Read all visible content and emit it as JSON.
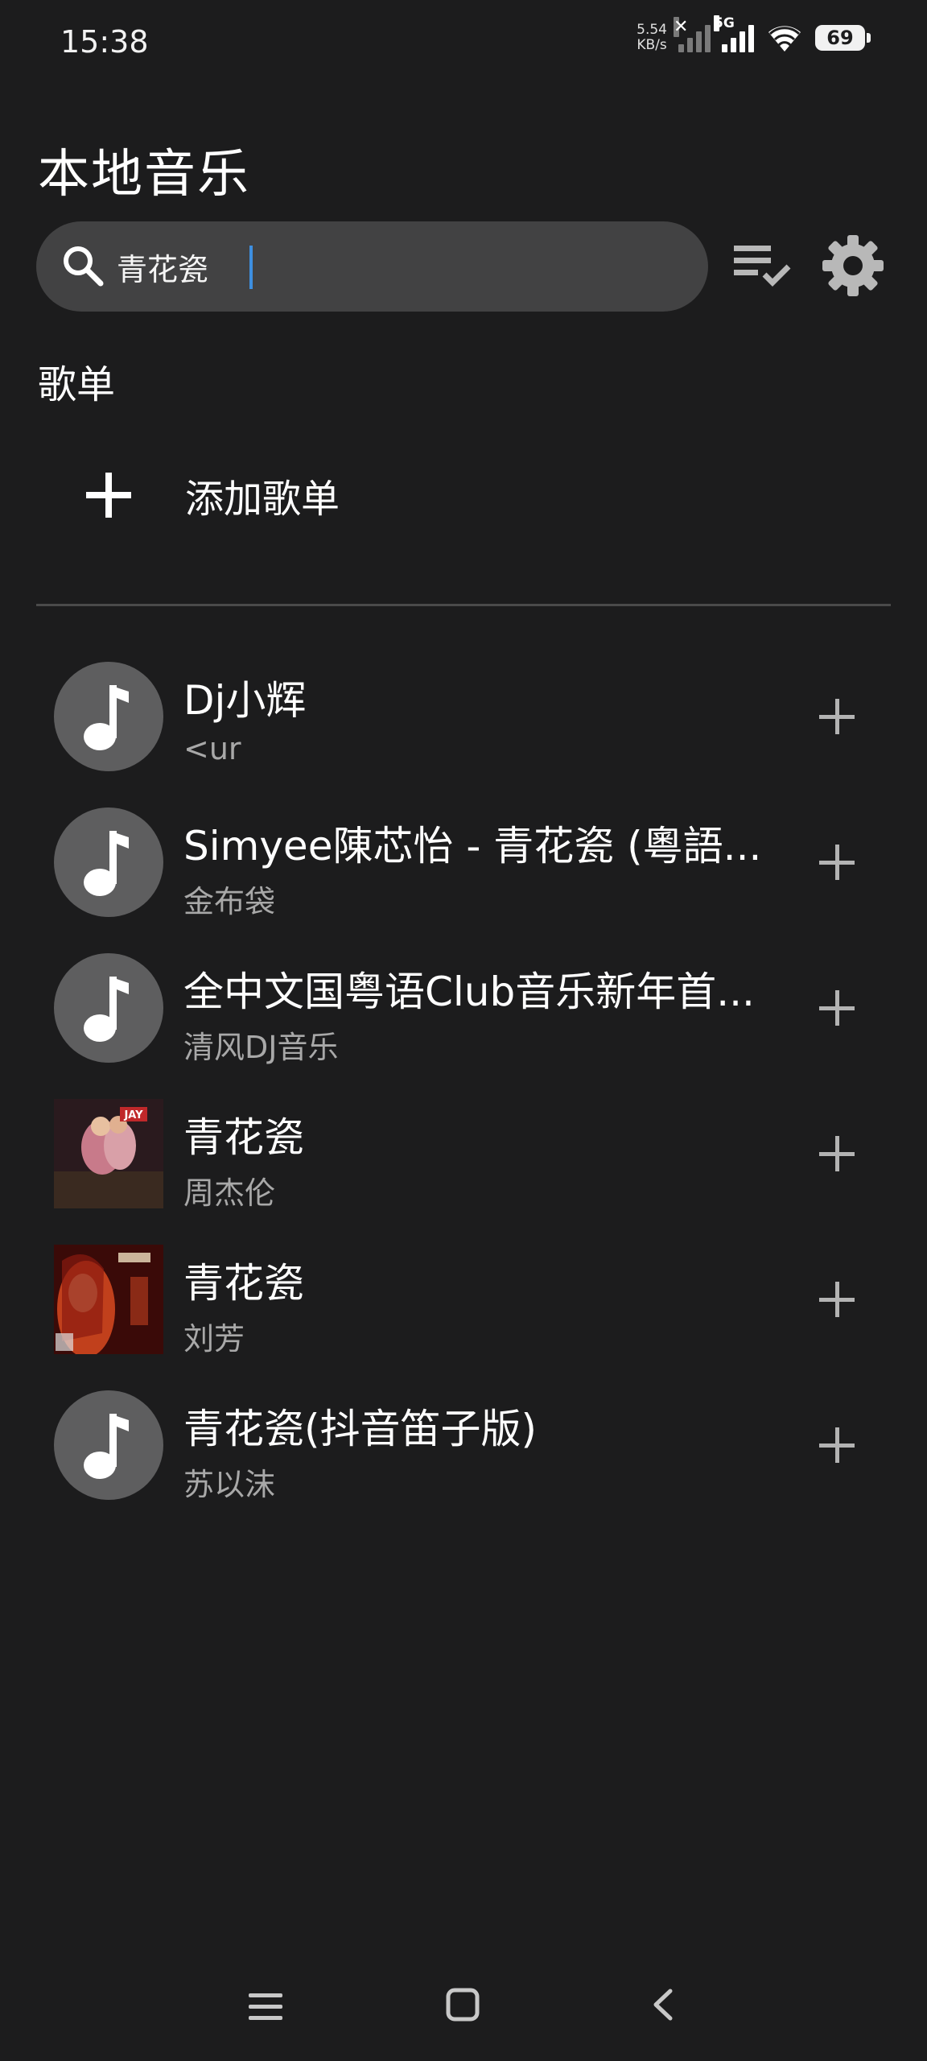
{
  "status_bar": {
    "time": "15:38",
    "net_speed_value": "5.54",
    "net_speed_unit": "KB/s",
    "network_type": "5G",
    "battery": "69"
  },
  "header": {
    "title": "本地音乐"
  },
  "search": {
    "value": "青花瓷",
    "placeholder": ""
  },
  "playlists": {
    "section_title": "歌单",
    "add_label": "添加歌单"
  },
  "songs": [
    {
      "title": " Dj小辉",
      "artist": "<ur",
      "cover": "music-note"
    },
    {
      "title": "Simyee陳芯怡 - 青花瓷 (粵語...",
      "artist": "金布袋",
      "cover": "music-note"
    },
    {
      "title": "全中文国粤语Club音乐新年首...",
      "artist": "清风DJ音乐",
      "cover": "music-note"
    },
    {
      "title": "青花瓷",
      "artist": "周杰伦",
      "cover": "album-art-jay"
    },
    {
      "title": "青花瓷",
      "artist": "刘芳",
      "cover": "album-art-liufang"
    },
    {
      "title": "青花瓷(抖音笛子版)",
      "artist": "苏以沫",
      "cover": "music-note"
    }
  ],
  "album_badge": "JAY",
  "colors": {
    "background": "#1c1c1d",
    "search_bg": "#424243",
    "accent_caret": "#3d8fe0",
    "cover_placeholder": "#5e5e5f"
  }
}
